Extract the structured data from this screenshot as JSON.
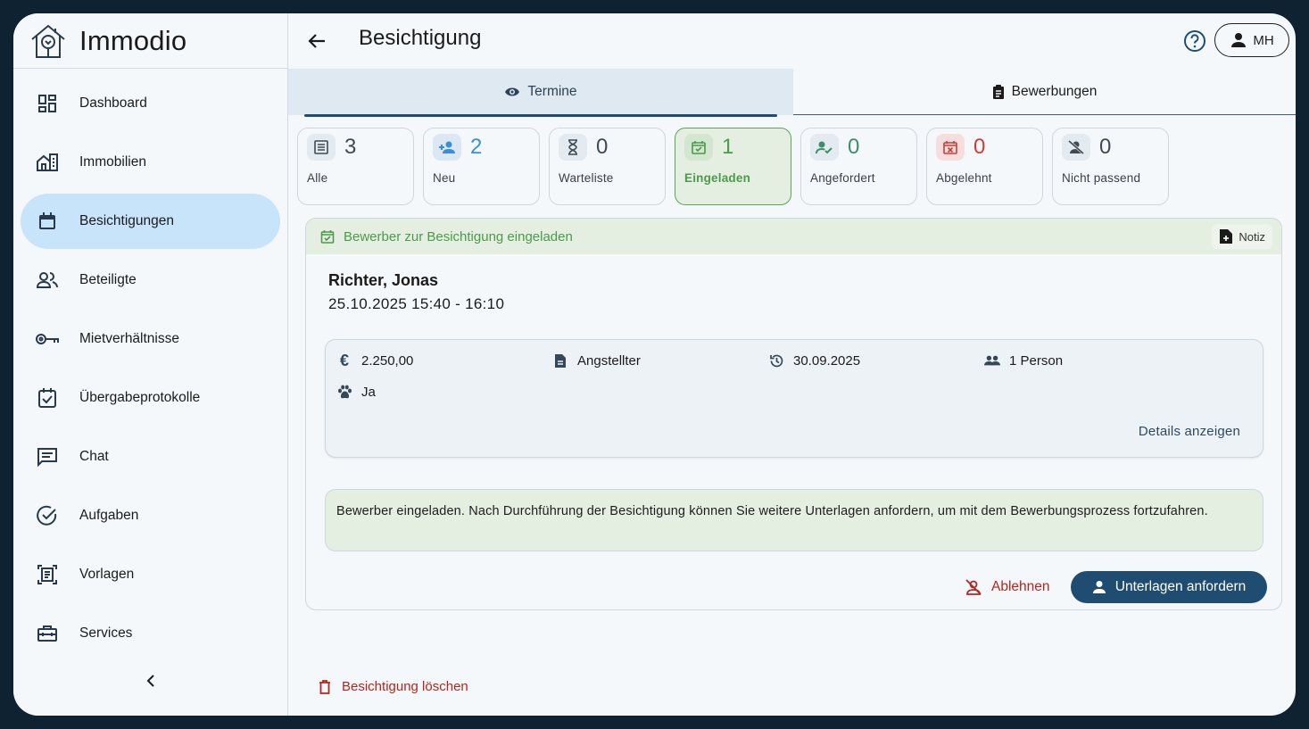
{
  "app": {
    "name": "Immodio",
    "logo_icon": "house-tree-logo"
  },
  "sidebar": {
    "items": [
      {
        "label": "Dashboard",
        "icon": "dashboard-icon",
        "active": false
      },
      {
        "label": "Immobilien",
        "icon": "building-icon",
        "active": false
      },
      {
        "label": "Besichtigungen",
        "icon": "calendar-icon",
        "active": true
      },
      {
        "label": "Beteiligte",
        "icon": "people-icon",
        "active": false
      },
      {
        "label": "Mietverhältnisse",
        "icon": "key-icon",
        "active": false
      },
      {
        "label": "Übergabeprotokolle",
        "icon": "checklist-icon",
        "active": false
      },
      {
        "label": "Chat",
        "icon": "chat-icon",
        "active": false
      },
      {
        "label": "Aufgaben",
        "icon": "check-circle-icon",
        "active": false
      },
      {
        "label": "Vorlagen",
        "icon": "template-icon",
        "active": false
      },
      {
        "label": "Services",
        "icon": "briefcase-icon",
        "active": false
      }
    ]
  },
  "header": {
    "title": "Besichtigung",
    "user_initials": "MH"
  },
  "tabs": [
    {
      "label": "Termine",
      "icon": "eye-icon",
      "active": true
    },
    {
      "label": "Bewerbungen",
      "icon": "clipboard-icon",
      "active": false
    }
  ],
  "stats": [
    {
      "label": "Alle",
      "count": "3",
      "icon": "list-icon",
      "color": "#404a52",
      "icon_bg": "#e3eaf0"
    },
    {
      "label": "Neu",
      "count": "2",
      "icon": "person-add-icon",
      "color": "#3b8fd6",
      "icon_bg": "#dbe8f4"
    },
    {
      "label": "Warteliste",
      "count": "0",
      "icon": "hourglass-icon",
      "color": "#404a52",
      "icon_bg": "#e3eaf0"
    },
    {
      "label": "Eingeladen",
      "count": "1",
      "icon": "calendar-check-icon",
      "color": "#4c9a4a",
      "icon_bg": "#d3e6cf",
      "active": true
    },
    {
      "label": "Angefordert",
      "count": "0",
      "icon": "person-check-icon",
      "color": "#3f8e6a",
      "icon_bg": "#e3eaf0"
    },
    {
      "label": "Abgelehnt",
      "count": "0",
      "icon": "calendar-x-icon",
      "color": "#d13b35",
      "icon_bg": "#f6dede"
    },
    {
      "label": "Nicht passend",
      "count": "0",
      "icon": "person-off-icon",
      "color": "#404a52",
      "icon_bg": "#e3eaf0"
    }
  ],
  "card": {
    "header": "Bewerber zur Besichtigung eingeladen",
    "note_label": "Notiz",
    "applicant_name": "Richter, Jonas",
    "datetime": "25.10.2025 15:40 - 16:10",
    "details": {
      "rent": "2.250,00",
      "employment": "Angstellter",
      "move_in": "30.09.2025",
      "persons": "1 Person",
      "pets": "Ja",
      "link": "Details anzeigen"
    },
    "info": "Bewerber eingeladen. Nach Durchführung der Besichtigung können Sie weitere Unterlagen anfordern, um mit dem Bewerbungsprozess fortzufahren.",
    "decline_label": "Ablehnen",
    "request_label": "Unterlagen anfordern"
  },
  "delete_label": "Besichtigung löschen",
  "colors": {
    "primary": "#1f4d72",
    "success": "#4c9a4a",
    "danger": "#b3261e",
    "active_nav": "#c7e4fa"
  }
}
